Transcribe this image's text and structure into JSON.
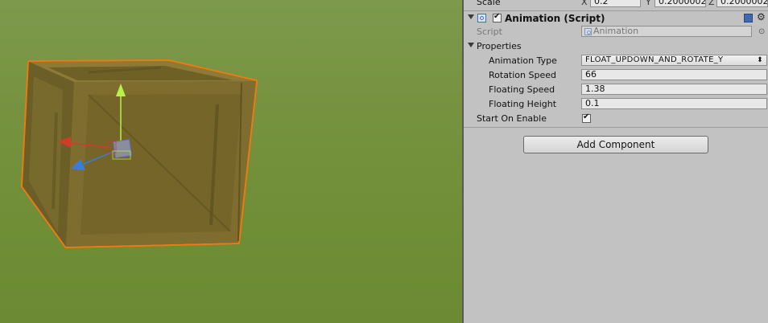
{
  "transform": {
    "scale_label": "Scale",
    "axis_x": "X",
    "axis_y": "Y",
    "axis_z": "Z",
    "scale_x": "0.2",
    "scale_y": "0.2000002",
    "scale_z": "0.2000002"
  },
  "component": {
    "title": "Animation (Script)",
    "enabled": true,
    "script_label": "Script",
    "script_value": "Animation",
    "properties_label": "Properties",
    "fields": [
      {
        "label": "Animation Type",
        "value": "FLOAT_UPDOWN_AND_ROTATE_Y",
        "kind": "dropdown"
      },
      {
        "label": "Rotation Speed",
        "value": "66",
        "kind": "text"
      },
      {
        "label": "Floating Speed",
        "value": "1.38",
        "kind": "text"
      },
      {
        "label": "Floating Height",
        "value": "0.1",
        "kind": "text"
      }
    ],
    "start_on_enable_label": "Start On Enable",
    "start_on_enable": true,
    "check_glyph": "✔",
    "dropdown_glyph": "⬍",
    "gear_glyph": "⚙",
    "object_picker_glyph": "⊙"
  },
  "add_component_label": "Add Component",
  "colors": {
    "scene_ground": "#76923f",
    "crate": "#7f6f2f",
    "selection_outline": "#f07a12",
    "gizmo_x": "#d23a2a",
    "gizmo_y": "#b6f24a",
    "gizmo_z": "#3a7be0"
  }
}
